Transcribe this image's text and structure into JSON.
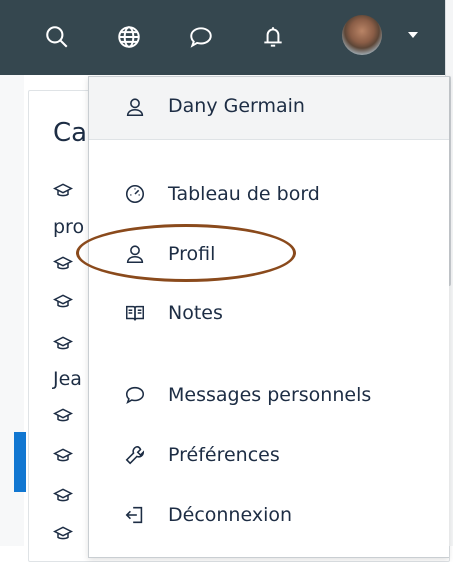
{
  "navbar": {
    "icons": [
      "search-icon",
      "globe-icon",
      "message-icon",
      "bell-icon"
    ],
    "background": "#35474f",
    "avatar_caret": "user-menu-caret"
  },
  "background_page": {
    "title_fragment": "Ca",
    "line1": "pro",
    "line2": "Jea"
  },
  "user_menu": {
    "user_name": "Dany Germain",
    "items": [
      {
        "label": "Tableau de bord",
        "icon": "dashboard-icon"
      },
      {
        "label": "Profil",
        "icon": "user-icon",
        "highlighted": true
      },
      {
        "label": "Notes",
        "icon": "book-icon"
      },
      {
        "label": "Messages personnels",
        "icon": "message-icon"
      },
      {
        "label": "Préférences",
        "icon": "wrench-icon"
      },
      {
        "label": "Déconnexion",
        "icon": "logout-icon"
      }
    ],
    "highlight_color": "#8a4a1c"
  }
}
